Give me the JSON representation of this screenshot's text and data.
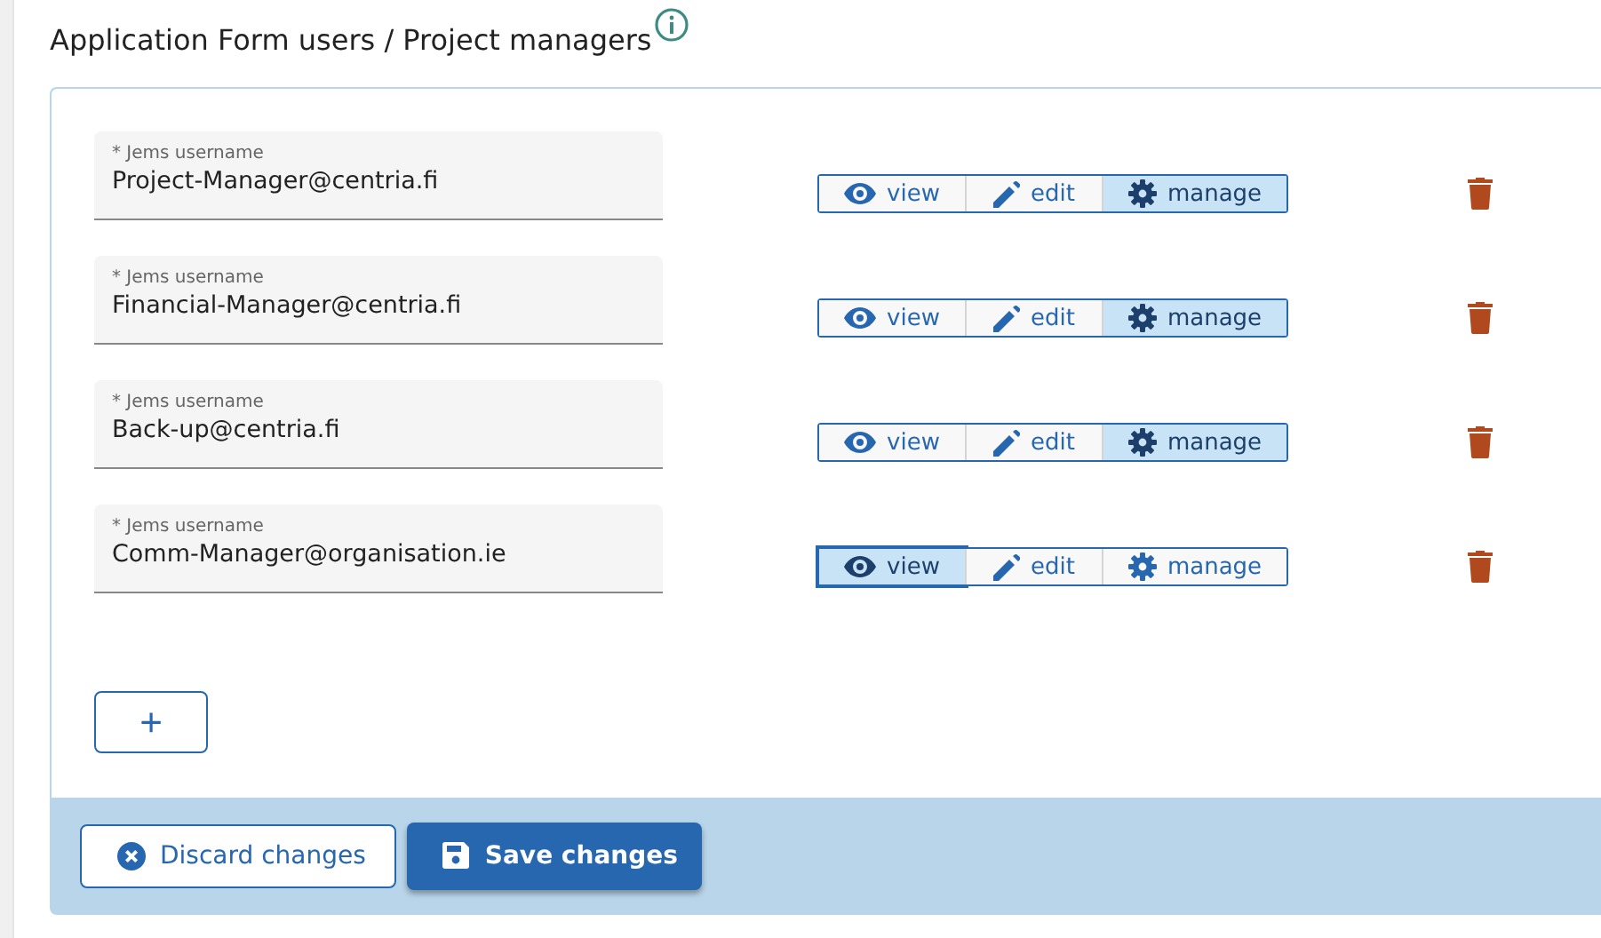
{
  "section": {
    "title": "Application Form users / Project managers"
  },
  "users": [
    {
      "label": "* Jems username",
      "value": "Project-Manager@centria.fi",
      "permissions": [
        {
          "kind": "view",
          "label": "view",
          "selected": false
        },
        {
          "kind": "edit",
          "label": "edit",
          "selected": false
        },
        {
          "kind": "manage",
          "label": "manage",
          "selected": true
        }
      ]
    },
    {
      "label": "* Jems username",
      "value": "Financial-Manager@centria.fi",
      "permissions": [
        {
          "kind": "view",
          "label": "view",
          "selected": false
        },
        {
          "kind": "edit",
          "label": "edit",
          "selected": false
        },
        {
          "kind": "manage",
          "label": "manage",
          "selected": true
        }
      ]
    },
    {
      "label": "* Jems username",
      "value": "Back-up@centria.fi",
      "permissions": [
        {
          "kind": "view",
          "label": "view",
          "selected": false
        },
        {
          "kind": "edit",
          "label": "edit",
          "selected": false
        },
        {
          "kind": "manage",
          "label": "manage",
          "selected": true
        }
      ]
    },
    {
      "label": "* Jems username",
      "value": "Comm-Manager@organisation.ie",
      "permissions": [
        {
          "kind": "view",
          "label": "view",
          "selected": true
        },
        {
          "kind": "edit",
          "label": "edit",
          "selected": false
        },
        {
          "kind": "manage",
          "label": "manage",
          "selected": false
        }
      ]
    }
  ],
  "add_button": {
    "label": "+"
  },
  "footer": {
    "discard": "Discard changes",
    "save": "Save changes"
  }
}
